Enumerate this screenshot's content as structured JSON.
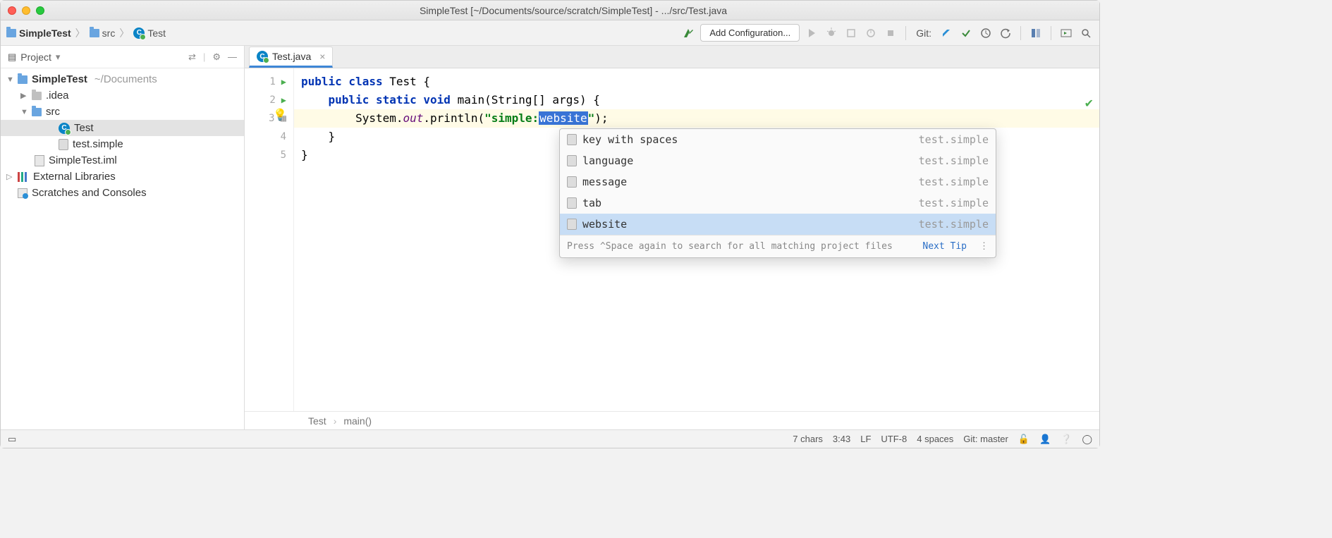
{
  "window": {
    "title": "SimpleTest [~/Documents/source/scratch/SimpleTest] - .../src/Test.java"
  },
  "breadcrumb": {
    "root": "SimpleTest",
    "folder": "src",
    "file": "Test"
  },
  "toolbar": {
    "add_config": "Add Configuration...",
    "git_label": "Git:"
  },
  "sidebar": {
    "title": "Project",
    "tree": {
      "root_name": "SimpleTest",
      "root_path": "~/Documents",
      "idea": ".idea",
      "src": "src",
      "test_class": "Test",
      "test_simple": "test.simple",
      "iml": "SimpleTest.iml",
      "ext_libs": "External Libraries",
      "scratches": "Scratches and Consoles"
    }
  },
  "editor": {
    "tab_name": "Test.java",
    "lines": {
      "l1_pre": "public class ",
      "l1_cls": "Test",
      "l1_post": " {",
      "l2_pre": "    public static void ",
      "l2_m": "main",
      "l2_post": "(String[] args) {",
      "l3_pre": "        System.",
      "l3_out": "out",
      "l3_p": ".println(",
      "l3_s1": "\"simple:",
      "l3_sel": "website",
      "l3_s2": "\"",
      "l3_end": ");",
      "l4": "    }",
      "l5": "}"
    },
    "bottom_bc": {
      "a": "Test",
      "b": "main()"
    }
  },
  "popup": {
    "items": [
      {
        "label": "key with spaces",
        "right": "test.simple",
        "selected": false
      },
      {
        "label": "language",
        "right": "test.simple",
        "selected": false
      },
      {
        "label": "message",
        "right": "test.simple",
        "selected": false
      },
      {
        "label": "tab",
        "right": "test.simple",
        "selected": false
      },
      {
        "label": "website",
        "right": "test.simple",
        "selected": true
      }
    ],
    "footer_hint": "Press ^Space again to search for all matching project files",
    "footer_link": "Next Tip"
  },
  "statusbar": {
    "chars": "7 chars",
    "pos": "3:43",
    "eol": "LF",
    "enc": "UTF-8",
    "indent": "4 spaces",
    "git": "Git: master"
  }
}
